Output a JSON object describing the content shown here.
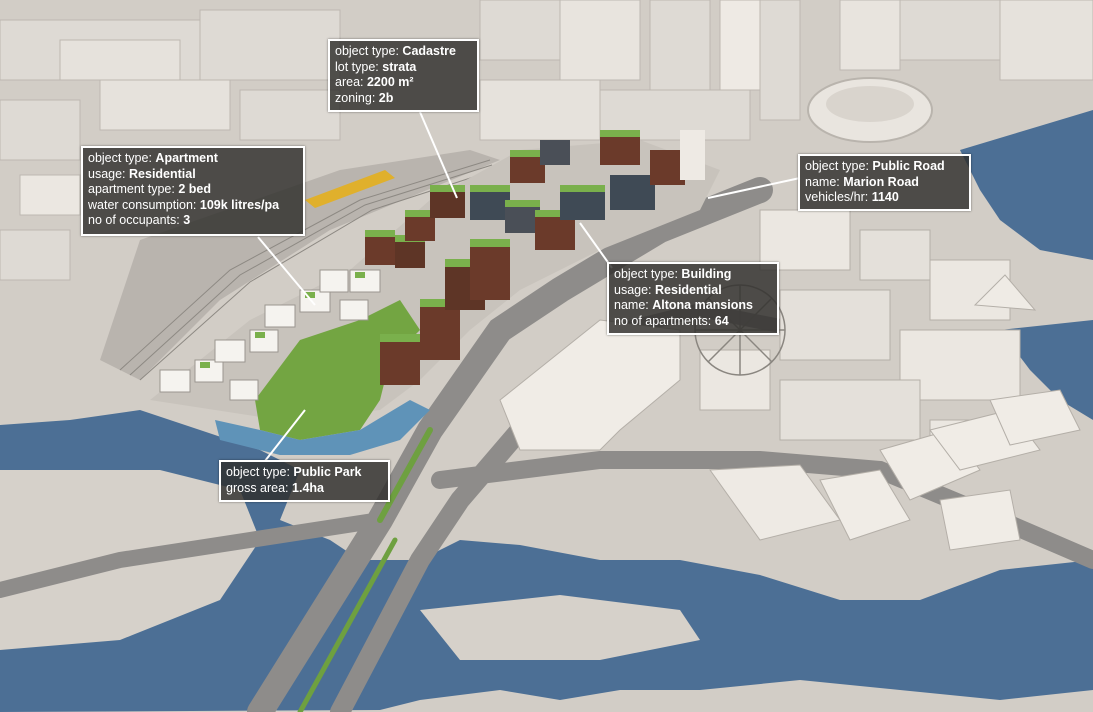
{
  "colors": {
    "water": "#4c6f95",
    "ground": "#d2cdc6",
    "road": "#8e8c8a",
    "park": "#73a542",
    "building": "#e9e5df",
    "label_bg": "#302e2c",
    "label_border": "#ffffff"
  },
  "callouts": {
    "cadastre": {
      "rows": [
        {
          "key": "object type:",
          "value": "Cadastre"
        },
        {
          "key": "lot type:",
          "value": "strata"
        },
        {
          "key": "area:",
          "value": "2200 m²"
        },
        {
          "key": "zoning:",
          "value": "2b"
        }
      ]
    },
    "apartment": {
      "rows": [
        {
          "key": "object type:",
          "value": "Apartment"
        },
        {
          "key": "usage:",
          "value": "Residential"
        },
        {
          "key": "apartment type:",
          "value": "2 bed"
        },
        {
          "key": "water consumption:",
          "value": "109k litres/pa"
        },
        {
          "key": "no of occupants:",
          "value": "3"
        }
      ]
    },
    "road": {
      "rows": [
        {
          "key": "object type:",
          "value": "Public Road"
        },
        {
          "key": "name:",
          "value": "Marion Road"
        },
        {
          "key": "vehicles/hr:",
          "value": "1140"
        }
      ]
    },
    "building": {
      "rows": [
        {
          "key": "object type:",
          "value": "Building"
        },
        {
          "key": "usage:",
          "value": "Residential"
        },
        {
          "key": "name:",
          "value": "Altona mansions"
        },
        {
          "key": "no of apartments:",
          "value": "64"
        }
      ]
    },
    "park": {
      "rows": [
        {
          "key": "object type:",
          "value": "Public Park"
        },
        {
          "key": "gross area:",
          "value": "1.4ha"
        }
      ]
    }
  }
}
